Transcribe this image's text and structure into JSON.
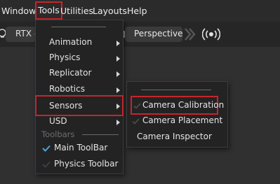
{
  "menubar": {
    "items": [
      "Window",
      "Tools",
      "Utilities",
      "Layouts",
      "Help"
    ]
  },
  "toolbar": {
    "renderer_label": "RTX -",
    "camera_label": "Perspective"
  },
  "tools_menu": {
    "items": [
      {
        "label": "Animation",
        "has_submenu": true
      },
      {
        "label": "Physics",
        "has_submenu": true
      },
      {
        "label": "Replicator",
        "has_submenu": true
      },
      {
        "label": "Robotics",
        "has_submenu": true
      },
      {
        "label": "Sensors",
        "has_submenu": true
      },
      {
        "label": "USD",
        "has_submenu": true
      }
    ],
    "toolbars_section_label": "Toolbars",
    "toolbar_items": [
      {
        "label": "Main ToolBar",
        "checked": true
      },
      {
        "label": "Physics Toolbar",
        "checked": false
      }
    ]
  },
  "sensors_submenu": {
    "items": [
      {
        "label": "Camera Calibration",
        "checked": true
      },
      {
        "label": "Camera Placement",
        "checked": true
      },
      {
        "label": "Camera Inspector",
        "checked": false
      }
    ]
  },
  "colors": {
    "highlight_red": "#c4262c",
    "check_blue": "#4aa3df",
    "menu_bg": "#232324"
  }
}
